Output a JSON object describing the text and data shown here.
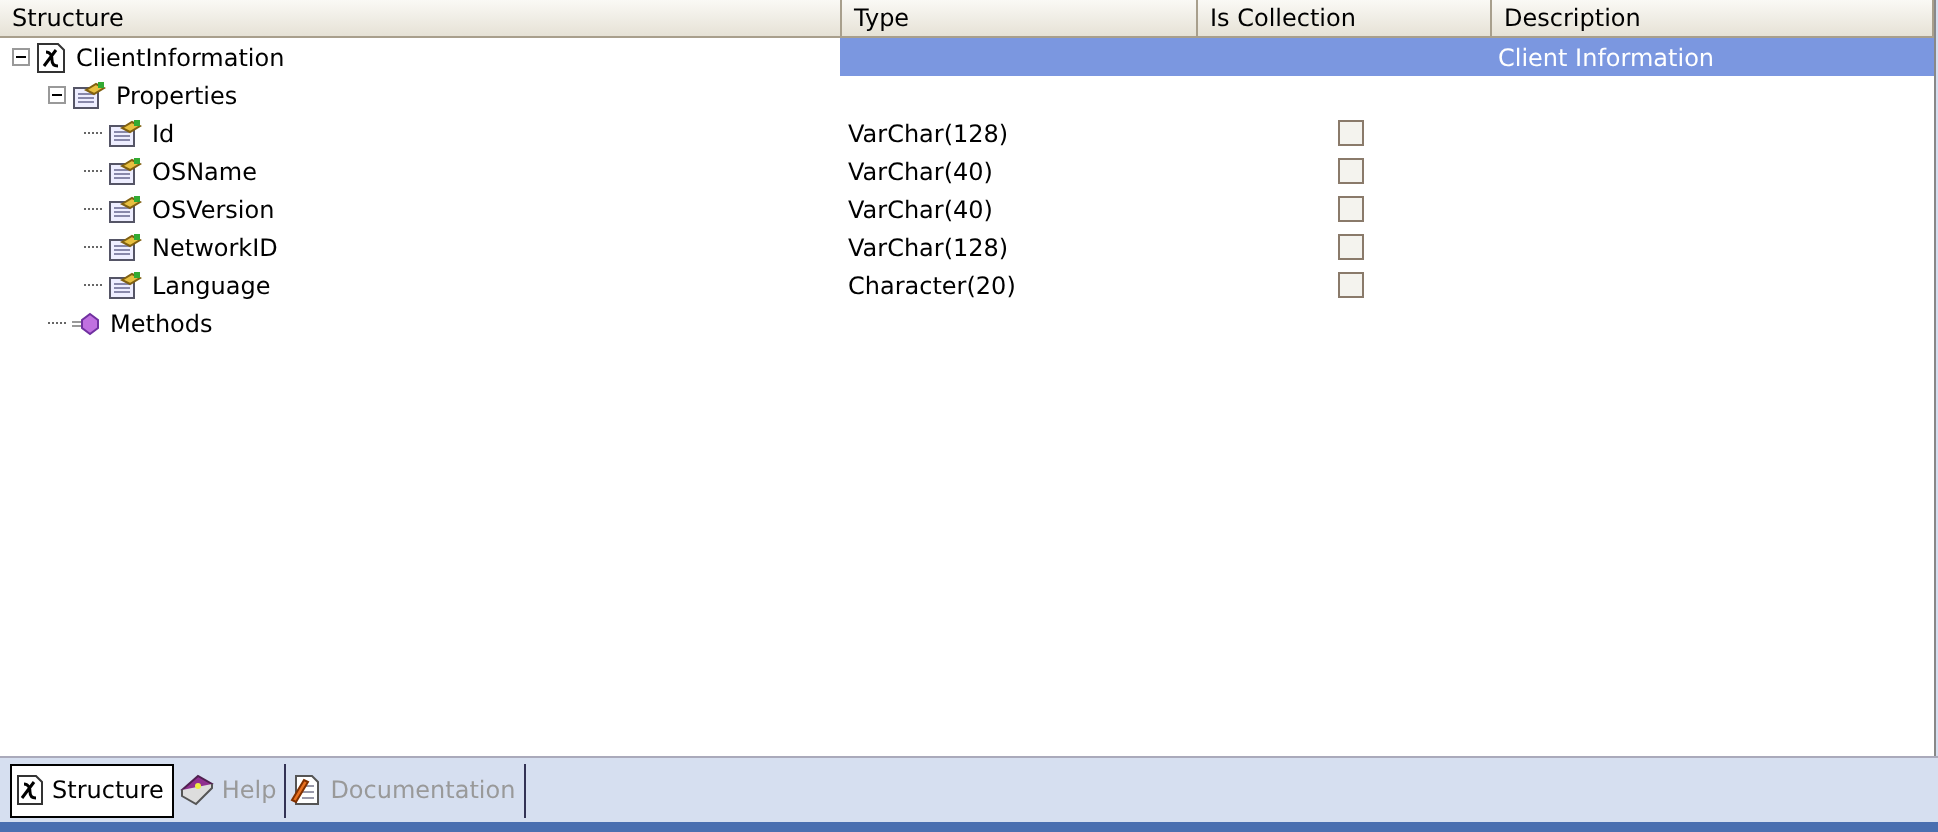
{
  "table": {
    "columns": [
      "Structure",
      "Type",
      "Is Collection",
      "Description"
    ],
    "rows": [
      {
        "kind": "class",
        "name": "ClientInformation",
        "expanded": true,
        "selected": true,
        "description": "Client Information",
        "children": [
          {
            "kind": "folder",
            "name": "Properties",
            "expanded": true,
            "selected": false,
            "children": [
              {
                "kind": "property",
                "name": "Id",
                "type": "VarChar(128)",
                "checked": false,
                "selected": false
              },
              {
                "kind": "property",
                "name": "OSName",
                "type": "VarChar(40)",
                "checked": false,
                "selected": false
              },
              {
                "kind": "property",
                "name": "OSVersion",
                "type": "VarChar(40)",
                "checked": false,
                "selected": false
              },
              {
                "kind": "property",
                "name": "NetworkID",
                "type": "VarChar(128)",
                "checked": false,
                "selected": false
              },
              {
                "kind": "property",
                "name": "Language",
                "type": "Character(20)",
                "checked": false,
                "selected": false
              }
            ]
          },
          {
            "kind": "methods",
            "name": "Methods",
            "selected": false
          }
        ]
      }
    ]
  },
  "tabs": [
    {
      "kind": "structure",
      "label": "Structure",
      "selected": true
    },
    {
      "kind": "help",
      "label": "Help",
      "selected": false
    },
    {
      "kind": "documentation",
      "label": "Documentation",
      "selected": false
    }
  ]
}
